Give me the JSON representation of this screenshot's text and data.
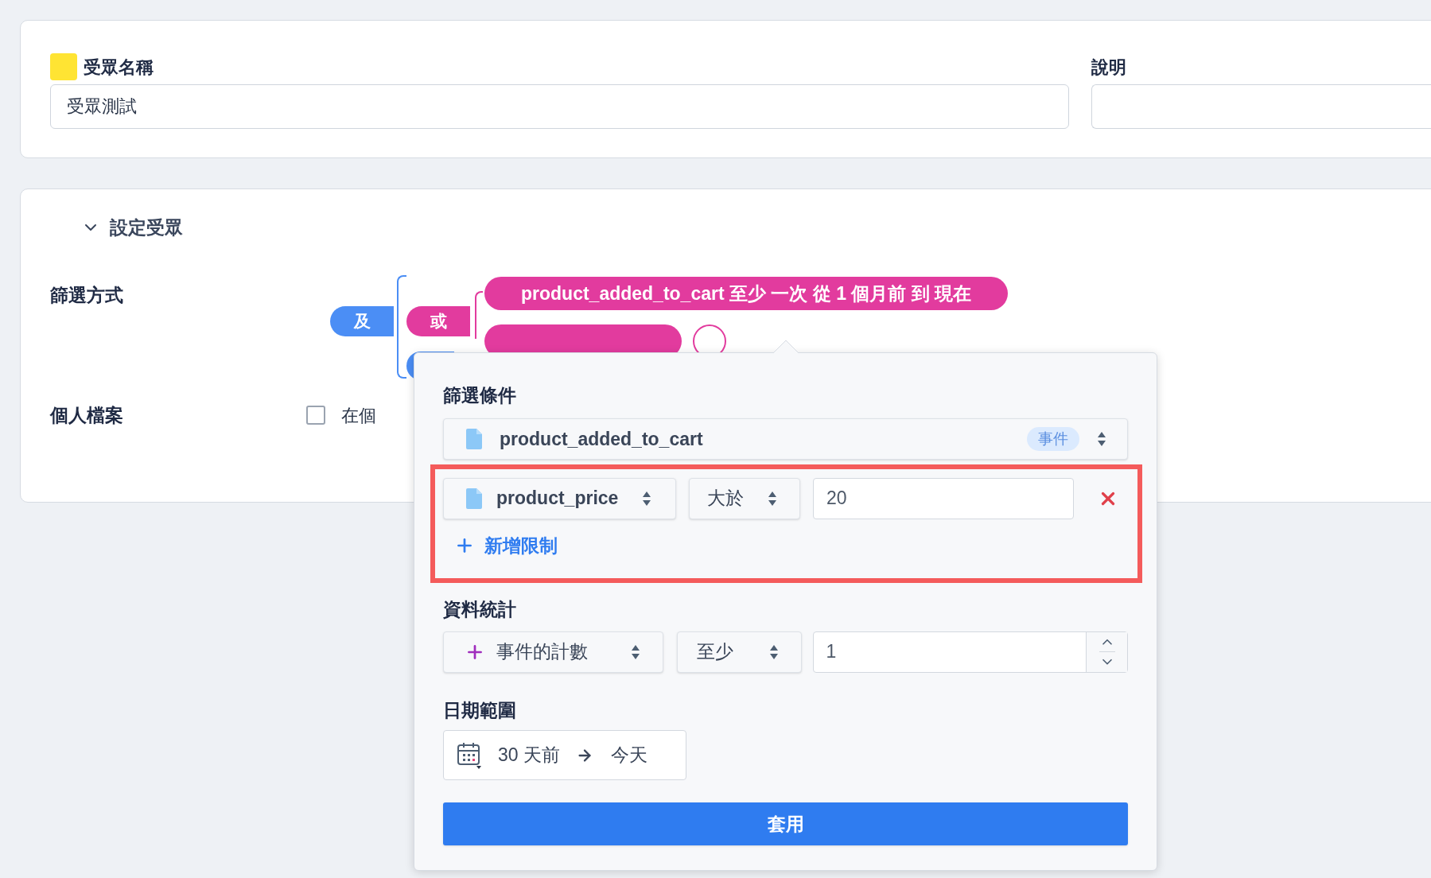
{
  "audience_name": {
    "label": "受眾名稱",
    "color": "#ffe433",
    "value": "受眾測試"
  },
  "description": {
    "label": "說明"
  },
  "section": {
    "title": "設定受眾",
    "expanded": true
  },
  "filter_method": {
    "label": "篩選方式",
    "and_label": "及",
    "or_label": "或",
    "conditions": [
      {
        "kind": "text",
        "text": "product_added_to_cart 至少 一次 從 1 個月前 到 現在"
      },
      {
        "kind": "covered"
      }
    ]
  },
  "profile": {
    "label": "個人檔案",
    "checked": false,
    "option": "在個"
  },
  "popup": {
    "filter_title": "篩選條件",
    "event": {
      "value": "product_added_to_cart",
      "tag": "事件"
    },
    "restrictions": [
      {
        "property": "product_price",
        "operator": "大於",
        "value": "20"
      }
    ],
    "add_restriction": "新增限制",
    "stats_title": "資料統計",
    "stat": {
      "measure": "事件的計數",
      "operator": "至少",
      "value": "1"
    },
    "date_title": "日期範圍",
    "date": {
      "from": "30 天前",
      "to": "今天"
    },
    "apply": "套用"
  }
}
